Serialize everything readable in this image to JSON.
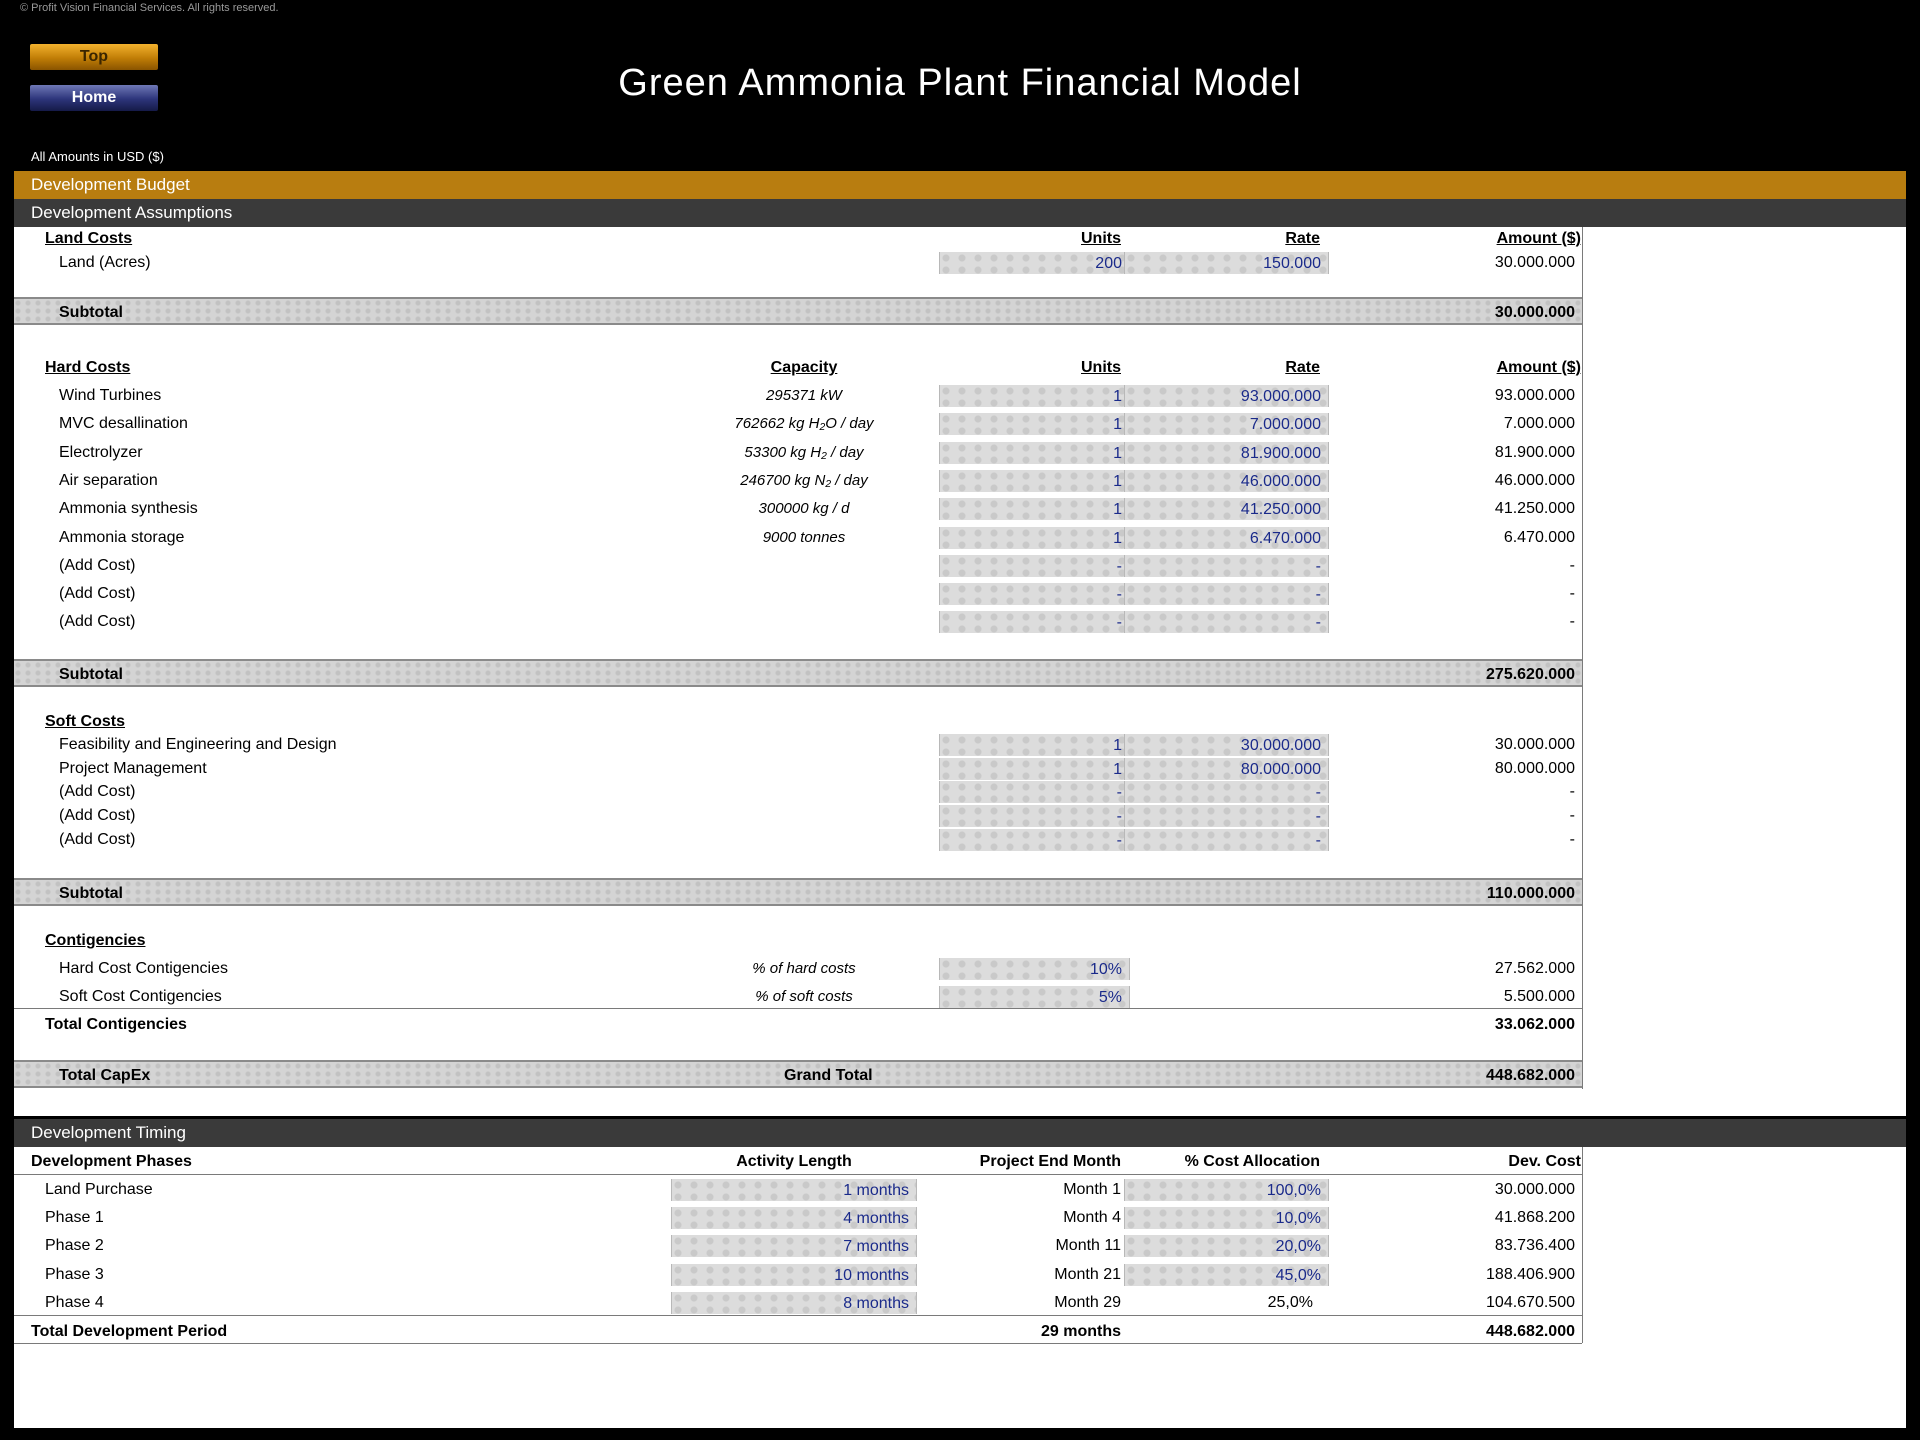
{
  "copyright": "© Profit Vision Financial Services. All rights reserved.",
  "nav": {
    "top": "Top",
    "home": "Home"
  },
  "title": "Green Ammonia Plant Financial Model",
  "amounts_note": "All Amounts in  USD ($)",
  "bands": {
    "budget": "Development Budget",
    "assumptions": "Development Assumptions",
    "timing": "Development Timing"
  },
  "land": {
    "heading": "Land Costs",
    "units_hdr": "Units",
    "rate_hdr": "Rate",
    "amount_hdr": "Amount ($)",
    "row": {
      "label": "Land (Acres)",
      "units": "200",
      "rate": "150.000",
      "amount": "30.000.000"
    },
    "subtotal_label": "Subtotal",
    "subtotal": "30.000.000"
  },
  "hard": {
    "heading": "Hard Costs",
    "capacity_hdr": "Capacity",
    "units_hdr": "Units",
    "rate_hdr": "Rate",
    "amount_hdr": "Amount ($)",
    "rows": [
      {
        "label": "Wind Turbines",
        "capacity": "295371 kW",
        "units": "1",
        "rate": "93.000.000",
        "amount": "93.000.000"
      },
      {
        "label": "MVC desallination",
        "capacity": "762662 kg H₂O / day",
        "units": "1",
        "rate": "7.000.000",
        "amount": "7.000.000"
      },
      {
        "label": "Electrolyzer",
        "capacity": "53300 kg H₂ / day",
        "units": "1",
        "rate": "81.900.000",
        "amount": "81.900.000"
      },
      {
        "label": "Air separation",
        "capacity": "246700 kg N₂ / day",
        "units": "1",
        "rate": "46.000.000",
        "amount": "46.000.000"
      },
      {
        "label": "Ammonia synthesis",
        "capacity": "300000 kg / d",
        "units": "1",
        "rate": "41.250.000",
        "amount": "41.250.000"
      },
      {
        "label": "Ammonia storage",
        "capacity": "9000 tonnes",
        "units": "1",
        "rate": "6.470.000",
        "amount": "6.470.000"
      },
      {
        "label": "(Add Cost)",
        "capacity": "",
        "units": "-",
        "rate": "-",
        "amount": "-"
      },
      {
        "label": "(Add Cost)",
        "capacity": "",
        "units": "-",
        "rate": "-",
        "amount": "-"
      },
      {
        "label": "(Add Cost)",
        "capacity": "",
        "units": "-",
        "rate": "-",
        "amount": "-"
      }
    ],
    "subtotal_label": "Subtotal",
    "subtotal": "275.620.000"
  },
  "soft": {
    "heading": "Soft Costs",
    "rows": [
      {
        "label": "Feasibility and Engineering and Design",
        "units": "1",
        "rate": "30.000.000",
        "amount": "30.000.000"
      },
      {
        "label": "Project Management",
        "units": "1",
        "rate": "80.000.000",
        "amount": "80.000.000"
      },
      {
        "label": "(Add Cost)",
        "units": "-",
        "rate": "-",
        "amount": "-"
      },
      {
        "label": "(Add Cost)",
        "units": "-",
        "rate": "-",
        "amount": "-"
      },
      {
        "label": "(Add Cost)",
        "units": "-",
        "rate": "-",
        "amount": "-"
      }
    ],
    "subtotal_label": "Subtotal",
    "subtotal": "110.000.000"
  },
  "contingencies": {
    "heading": "Contigencies",
    "rows": [
      {
        "label": "Hard Cost Contigencies",
        "basis": "% of hard costs",
        "pct": "10%",
        "amount": "27.562.000"
      },
      {
        "label": "Soft Cost Contigencies",
        "basis": "% of soft costs",
        "pct": "5%",
        "amount": "5.500.000"
      }
    ],
    "total_label": "Total Contigencies",
    "total": "33.062.000"
  },
  "capex": {
    "label": "Total CapEx",
    "middle": "Grand Total",
    "total": "448.682.000"
  },
  "timing": {
    "headers": {
      "phases": "Development Phases",
      "length": "Activity Length",
      "end": "Project End Month",
      "alloc": "% Cost Allocation",
      "cost": "Dev. Cost"
    },
    "rows": [
      {
        "label": "Land Purchase",
        "length": "1 months",
        "end": "Month 1",
        "alloc": "100,0%",
        "cost": "30.000.000",
        "alloc_input": true
      },
      {
        "label": "Phase 1",
        "length": "4 months",
        "end": "Month 4",
        "alloc": "10,0%",
        "cost": "41.868.200",
        "alloc_input": true
      },
      {
        "label": "Phase 2",
        "length": "7 months",
        "end": "Month 11",
        "alloc": "20,0%",
        "cost": "83.736.400",
        "alloc_input": true
      },
      {
        "label": "Phase 3",
        "length": "10 months",
        "end": "Month 21",
        "alloc": "45,0%",
        "cost": "188.406.900",
        "alloc_input": true
      },
      {
        "label": "Phase 4",
        "length": "8 months",
        "end": "Month 29",
        "alloc": "25,0%",
        "cost": "104.670.500",
        "alloc_input": false
      }
    ],
    "total_label": "Total Development Period",
    "total_length": "29 months",
    "total_cost": "448.682.000"
  }
}
